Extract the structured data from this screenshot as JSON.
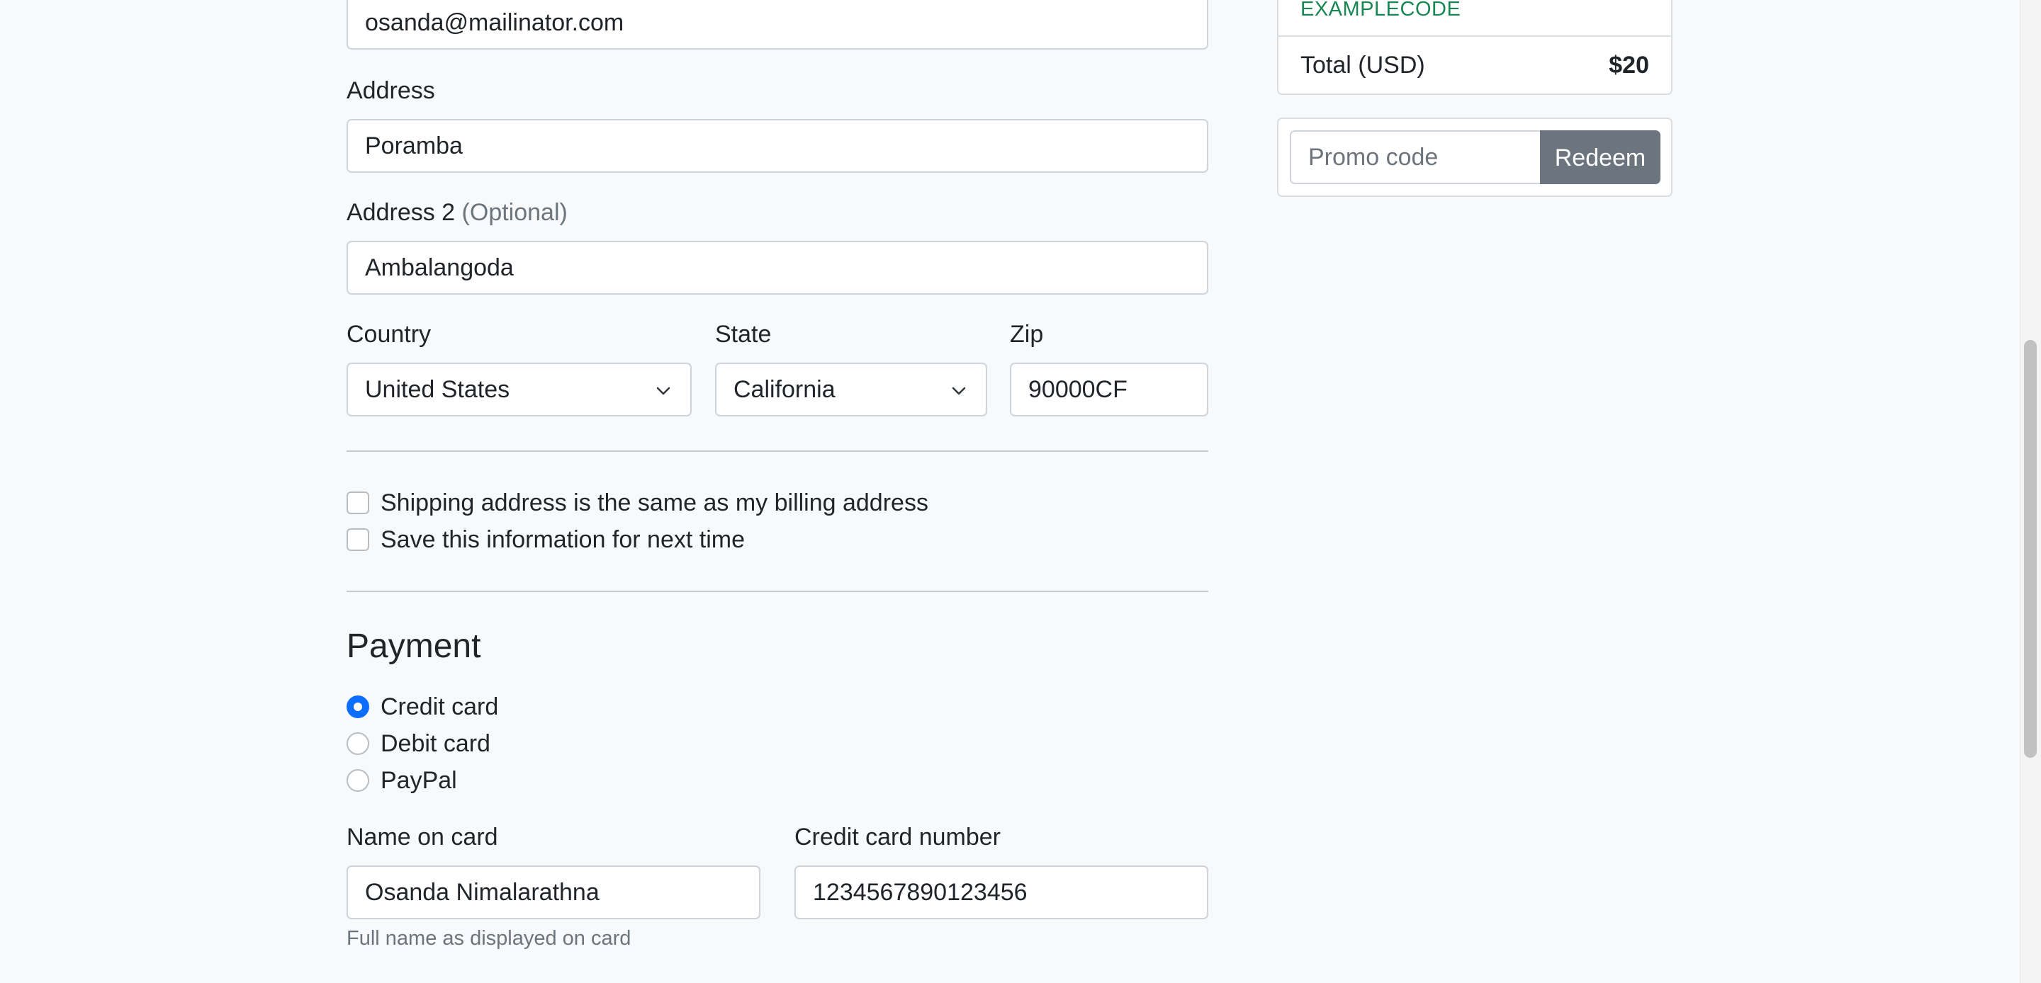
{
  "billing": {
    "email_value": "osanda@mailinator.com",
    "address_label": "Address",
    "address_value": "Poramba",
    "address2_label": "Address 2",
    "address2_optional": "(Optional)",
    "address2_value": "Ambalangoda",
    "country_label": "Country",
    "country_value": "United States",
    "state_label": "State",
    "state_value": "California",
    "zip_label": "Zip",
    "zip_value": "90000CF"
  },
  "options": {
    "same_address_label": "Shipping address is the same as my billing address",
    "save_info_label": "Save this information for next time"
  },
  "payment": {
    "heading": "Payment",
    "methods": [
      {
        "label": "Credit card",
        "checked": true
      },
      {
        "label": "Debit card",
        "checked": false
      },
      {
        "label": "PayPal",
        "checked": false
      }
    ],
    "name_on_card_label": "Name on card",
    "name_on_card_value": "Osanda Nimalarathna",
    "name_on_card_help": "Full name as displayed on card",
    "card_number_label": "Credit card number",
    "card_number_value": "1234567890123456"
  },
  "cart": {
    "promo_applied_code": "EXAMPLECODE",
    "total_label": "Total (USD)",
    "total_value": "$20"
  },
  "promo": {
    "placeholder": "Promo code",
    "redeem_label": "Redeem"
  },
  "colors": {
    "accent": "#0d6efd",
    "success": "#198754",
    "secondary": "#6c757d"
  }
}
